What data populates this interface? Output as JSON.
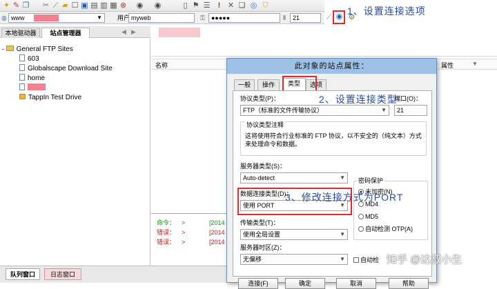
{
  "toolbar": {
    "icons": [
      "new-connection-icon",
      "pin-icon",
      "copy-icon",
      "edit-icon",
      "connect-icon",
      "folder-icon",
      "open-icon",
      "save-icon",
      "print-icon",
      "delete-icon",
      "back-icon",
      "forward-icon",
      "properties-icon",
      "settings-icon",
      "flag-icon",
      "alert-icon",
      "cancel-icon",
      "paste-icon",
      "refresh-icon",
      "shield-icon"
    ]
  },
  "address_bar": {
    "host_value": "www",
    "user_label": "用户",
    "user_value": "myweb",
    "password_value": "●●●●●",
    "port_value": "21"
  },
  "left_tabs": [
    "本地驱动器",
    "站点管理器"
  ],
  "tree": {
    "root": "General FTP Sites",
    "items": [
      "603",
      "Globalscape Download Site",
      "home",
      "",
      "TappIn Test Drive"
    ]
  },
  "file_list": {
    "name_header": "名称",
    "attr_header": "属性"
  },
  "log": {
    "rows": [
      {
        "tag": "命令：",
        "arrow": ">",
        "time": "[2014"
      },
      {
        "tag": "错误：",
        "arrow": ">",
        "time": "[2014"
      },
      {
        "tag": "错误：",
        "arrow": ">",
        "time": "[2014"
      }
    ]
  },
  "bottom_tabs": [
    "队列窗口",
    "日志窗口"
  ],
  "dialog": {
    "title": "此对象的站点属性：",
    "tabs": [
      "一般",
      "操作",
      "类型",
      "选项"
    ],
    "protocol_label": "协议类型(P)：",
    "protocol_value": "FTP（标准的文件传输协议）",
    "port_label": "端口(O)：",
    "port_value": "21",
    "notes_label": "协议类型注释",
    "notes_text": "这将使用符合行业标准的 FTP 协议，以不安全的（纯文本）方式来处理命令和数据。",
    "server_type_label": "服务器类型(S)：",
    "server_type_value": "Auto-detect",
    "password_protect_label": "密码保护",
    "radio_options": [
      {
        "label": "未加密(N)",
        "checked": true
      },
      {
        "label": "MD4",
        "checked": false
      },
      {
        "label": "MD5",
        "checked": false
      },
      {
        "label": "自动检测 OTP(A)",
        "checked": false
      }
    ],
    "conn_type_label": "数据连接类型(D)：",
    "conn_type_value": "使用 PORT",
    "transfer_label": "传输类型(T)：",
    "transfer_value": "使用全局设置",
    "timezone_label": "服务器时区(Z)：",
    "timezone_value": "无偏移",
    "auto_check_label": "自动检",
    "buttons": [
      "连接(F)",
      "确定",
      "取消",
      "帮助"
    ]
  },
  "annotations": {
    "step1": "1、设置连接选项",
    "step2": "2、设置连接类型",
    "step3": "3、修改连接方式为PORT"
  },
  "watermark": "知乎 @达叔小生",
  "colors": {
    "annotation_blue": "#2a4aa8",
    "highlight_red": "#e8262c",
    "dialog_title": "#9cc0e6"
  }
}
